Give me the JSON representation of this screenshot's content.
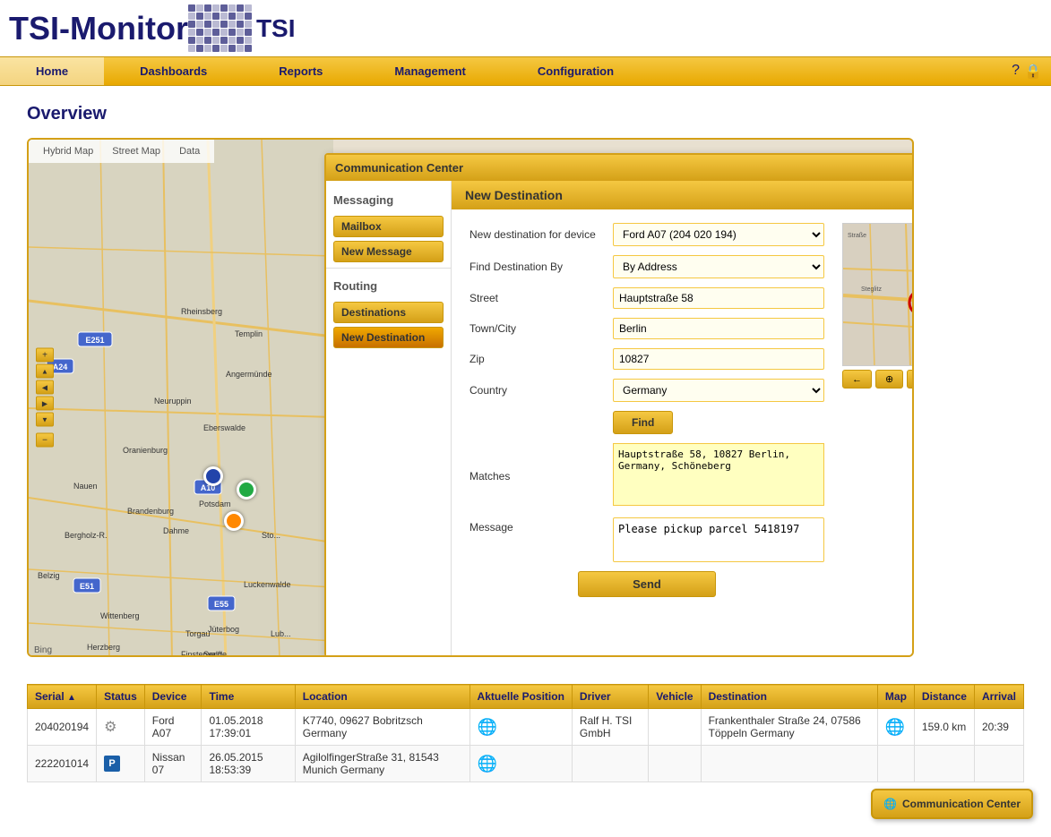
{
  "header": {
    "title": "TSI-Monitor",
    "logo_alt": "TSI Logo"
  },
  "nav": {
    "items": [
      {
        "label": "Home",
        "active": true
      },
      {
        "label": "Dashboards",
        "active": false
      },
      {
        "label": "Reports",
        "active": false
      },
      {
        "label": "Management",
        "active": false
      },
      {
        "label": "Configuration",
        "active": false
      }
    ]
  },
  "page": {
    "title": "Overview"
  },
  "map": {
    "tab1": "Hybrid Map",
    "tab2": "Street Map",
    "tab3": "Data",
    "bing_label": "Bing"
  },
  "comm_center": {
    "title": "Communication Center",
    "close_label": "✕",
    "new_destination_title": "New Destination",
    "sidebar": {
      "messaging_label": "Messaging",
      "mailbox_label": "Mailbox",
      "new_message_label": "New Message",
      "routing_label": "Routing",
      "destinations_label": "Destinations",
      "new_destination_label": "New Destination"
    },
    "form": {
      "device_label": "New destination for device",
      "device_value": "Ford A07 (204 020 194)",
      "find_by_label": "Find Destination By",
      "find_by_value": "By Address",
      "street_label": "Street",
      "street_value": "Hauptstraße 58",
      "town_label": "Town/City",
      "town_value": "Berlin",
      "zip_label": "Zip",
      "zip_value": "10827",
      "country_label": "Country",
      "country_value": "Germany",
      "find_btn": "Find",
      "matches_label": "Matches",
      "matches_value": "Hauptstraße 58, 10827 Berlin, Germany, Schöneberg",
      "message_label": "Message",
      "message_value": "Please pickup parcel 5418197",
      "send_btn": "Send"
    }
  },
  "table": {
    "columns": [
      "Serial",
      "Status",
      "Device",
      "Time",
      "Location",
      "Aktuelle Position",
      "Driver",
      "Vehicle",
      "Destination",
      "Map",
      "Distance",
      "Arrival"
    ],
    "rows": [
      {
        "serial": "204020194",
        "status_type": "moving",
        "device": "Ford A07",
        "time": "01.05.2018 17:39:01",
        "location": "K7740, 09627 Bobritzsch Germany",
        "has_position": true,
        "driver": "Ralf H. TSI GmbH",
        "vehicle": "",
        "destination": "Frankenthaler Straße 24, 07586 Töppeln Germany",
        "has_map": true,
        "distance": "159.0 km",
        "arrival": "20:39"
      },
      {
        "serial": "222201014",
        "status_type": "parking",
        "device": "Nissan 07",
        "time": "26.05.2015 18:53:39",
        "location": "AgilolfingerStraße 31, 81543 Munich Germany",
        "has_position": true,
        "driver": "",
        "vehicle": "",
        "destination": "",
        "has_map": false,
        "distance": "",
        "arrival": ""
      }
    ]
  },
  "floating": {
    "comm_center_label": "Communication Center",
    "globe_label": "🌐"
  }
}
